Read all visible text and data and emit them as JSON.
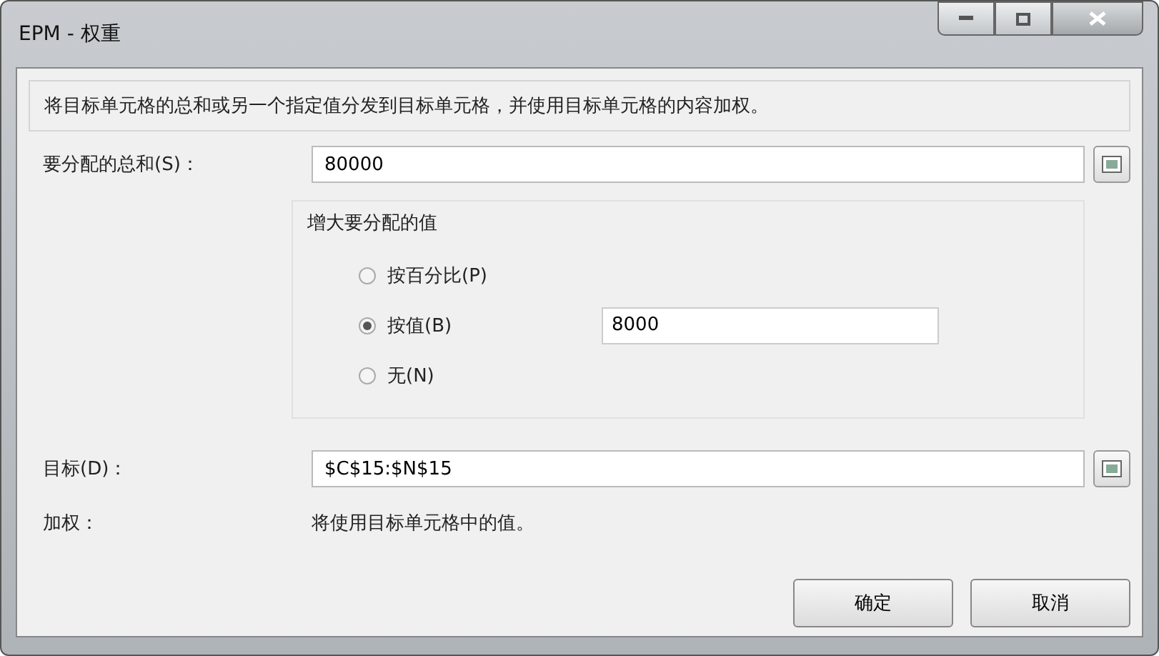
{
  "window": {
    "title": "EPM - 权重"
  },
  "description": "将目标单元格的总和或另一个指定值分发到目标单元格，并使用目标单元格的内容加权。",
  "sum_field": {
    "label": "要分配的总和(S)：",
    "value": "80000"
  },
  "increase_group": {
    "title": "增大要分配的值",
    "options": [
      {
        "label": "按百分比(P)",
        "selected": false
      },
      {
        "label": "按值(B)",
        "selected": true,
        "value": "8000"
      },
      {
        "label": "无(N)",
        "selected": false
      }
    ]
  },
  "target_field": {
    "label": "目标(D)：",
    "value": "$C$15:$N$15"
  },
  "weight": {
    "label": "加权：",
    "text": "将使用目标单元格中的值。"
  },
  "buttons": [
    "确定",
    "取消"
  ]
}
